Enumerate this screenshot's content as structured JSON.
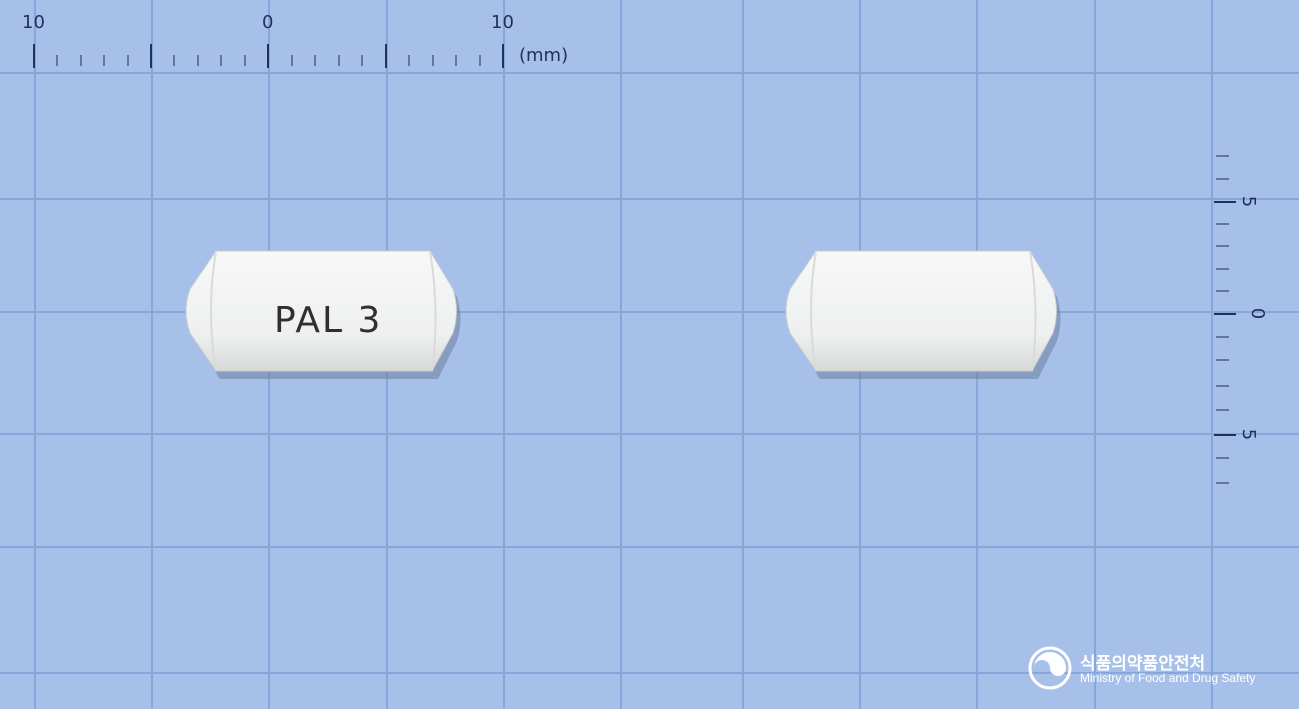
{
  "top_ruler": {
    "labels": [
      "10",
      "0",
      "10"
    ],
    "unit": "(mm)"
  },
  "side_ruler": {
    "labels": [
      "5",
      "0",
      "5"
    ]
  },
  "pills": [
    {
      "name": "pill-front",
      "imprint": "PAL 3"
    },
    {
      "name": "pill-back",
      "imprint": ""
    }
  ],
  "watermark": {
    "korean": "식품의약품안전처",
    "english": "Ministry of Food and Drug Safety"
  },
  "colors": {
    "background": "#a7c0ea",
    "grid": "#86a7dc",
    "ruler_ink": "#22315a",
    "pill_body": "#f1f3f2"
  }
}
